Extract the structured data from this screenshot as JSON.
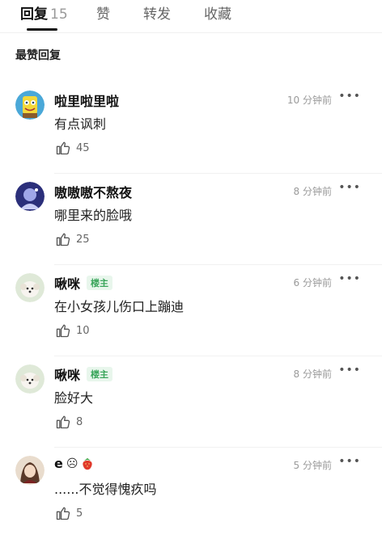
{
  "tabs": [
    {
      "label": "回复",
      "count": "15"
    },
    {
      "label": "赞"
    },
    {
      "label": "转发"
    },
    {
      "label": "收藏"
    }
  ],
  "section_title": "最赞回复",
  "comments": [
    {
      "username": "啦里啦里啦",
      "time": "10 分钟前",
      "text": "有点讽刺",
      "likes": "45",
      "more": "•••"
    },
    {
      "username": "嗷嗷嗷不熬夜",
      "time": "8 分钟前",
      "text": "哪里来的脸哦",
      "likes": "25",
      "more": "•••"
    },
    {
      "username": "啾咪",
      "badge": "楼主",
      "time": "6 分钟前",
      "text": "在小女孩儿伤口上蹦迪",
      "likes": "10",
      "more": "•••"
    },
    {
      "username": "啾咪",
      "badge": "楼主",
      "time": "8 分钟前",
      "text": "脸好大",
      "likes": "8",
      "more": "•••"
    },
    {
      "username": "e",
      "username_mark": "☹",
      "time": "5 分钟前",
      "text": "......不觉得愧疚吗",
      "likes": "5",
      "more": "•••"
    }
  ],
  "colors": {
    "badge_text": "#3aa55b",
    "badge_bg": "#e8f6ec",
    "meta_gray": "#9a9a9a"
  },
  "icons": [
    "thumbs-up-icon",
    "more-icon",
    "strawberry-icon"
  ]
}
